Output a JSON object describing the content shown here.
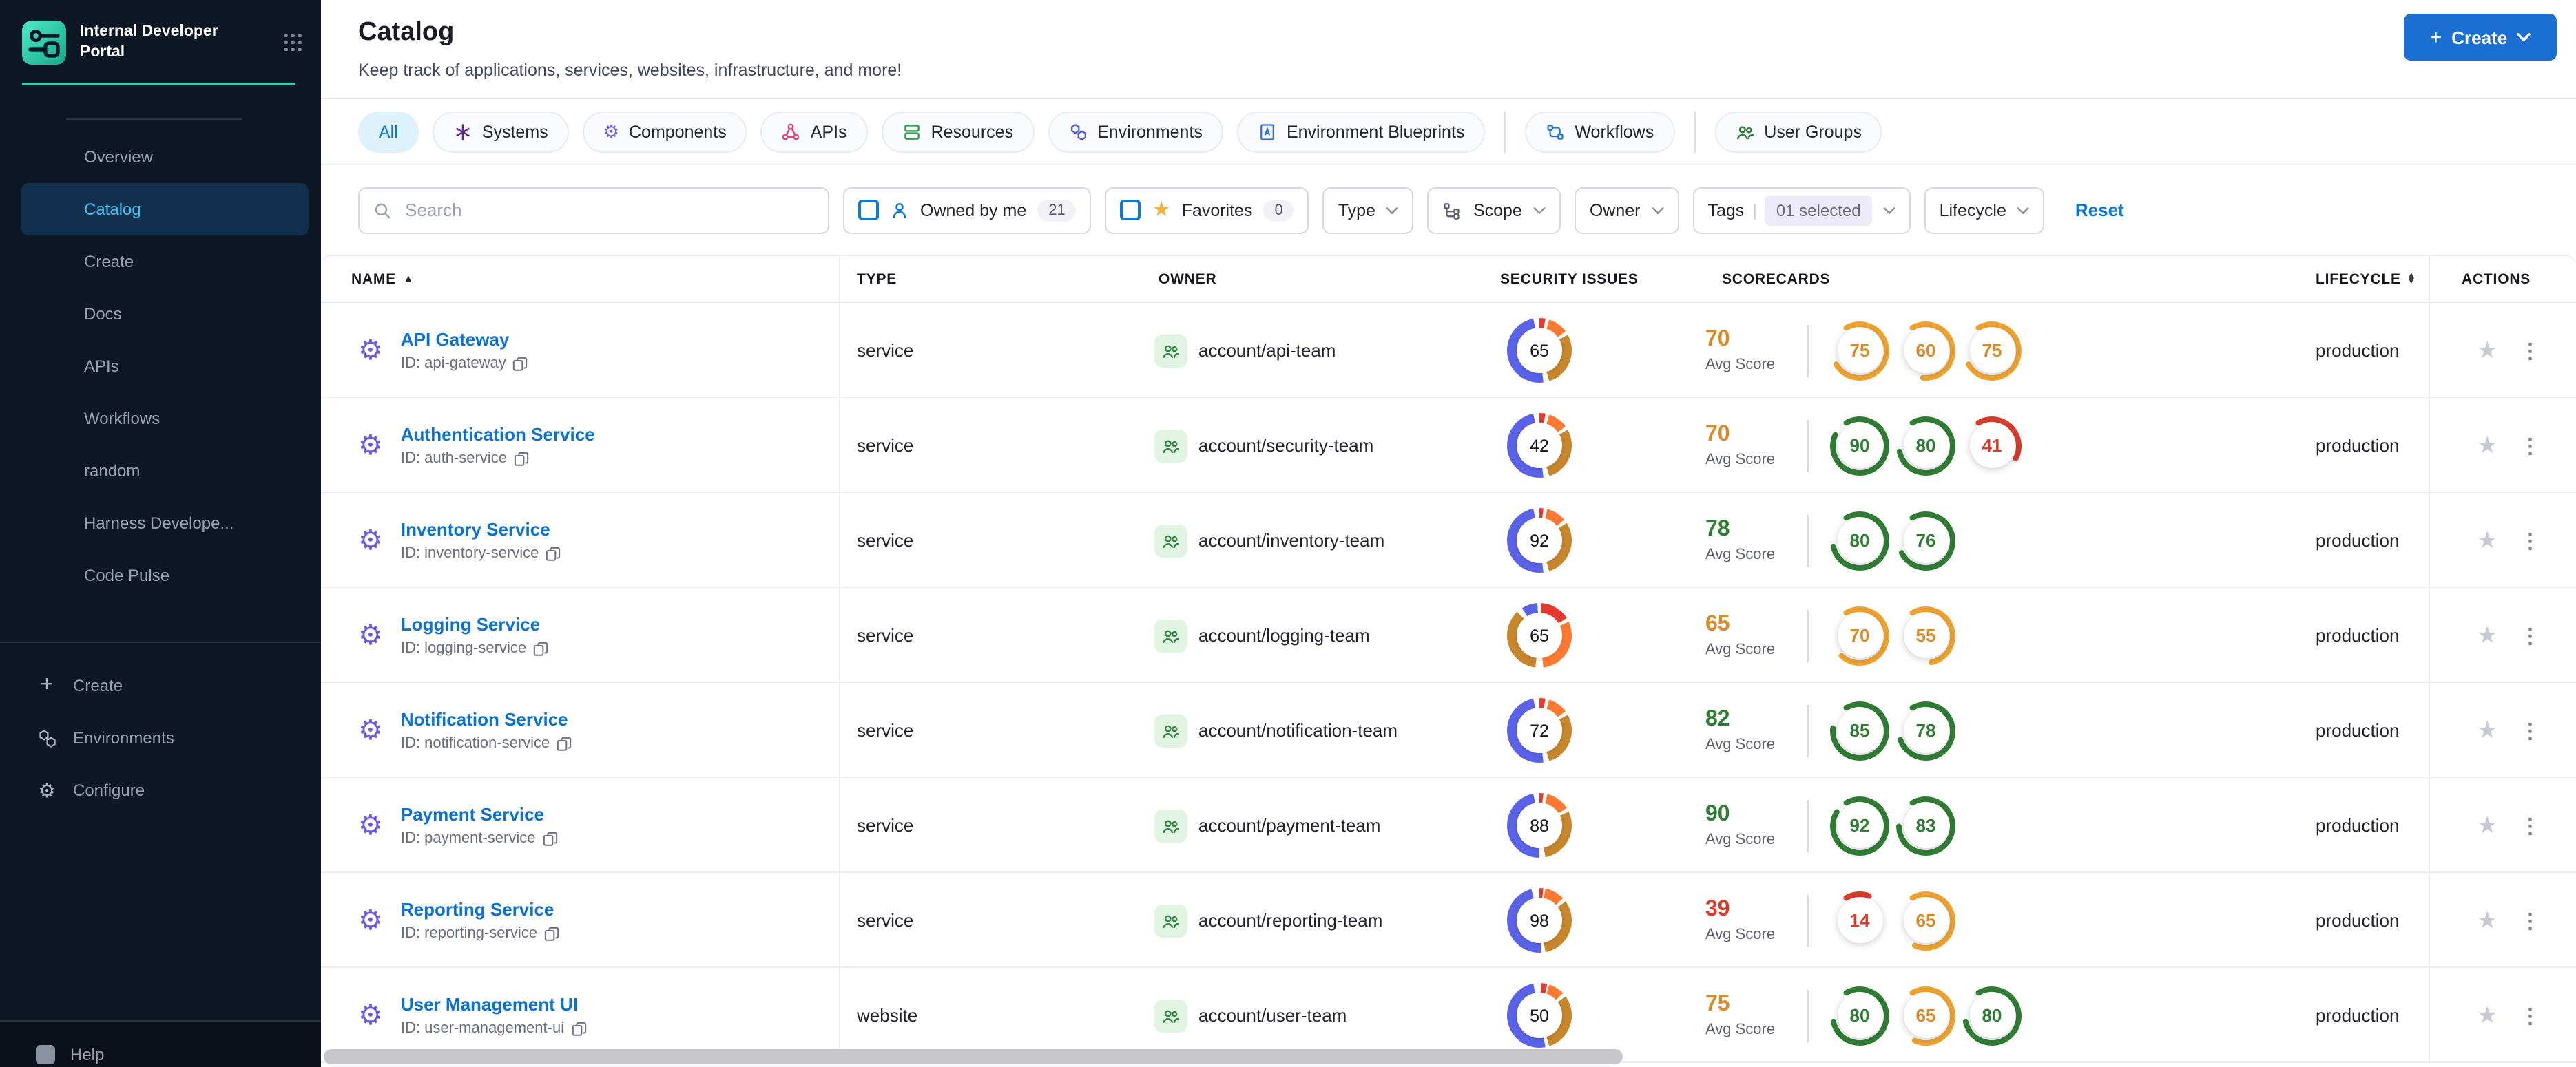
{
  "app_title": "Internal Developer Portal",
  "header": {
    "title": "Catalog",
    "subtitle": "Keep track of applications, services, websites, infrastructure, and more!",
    "create_button": "Create"
  },
  "sidebar": {
    "items": [
      {
        "label": "Overview"
      },
      {
        "label": "Catalog",
        "selected": true
      },
      {
        "label": "Create"
      },
      {
        "label": "Docs"
      },
      {
        "label": "APIs"
      },
      {
        "label": "Workflows"
      },
      {
        "label": "random"
      },
      {
        "label": "Harness Develope..."
      },
      {
        "label": "Code Pulse"
      }
    ],
    "bottom_items": [
      {
        "label": "Create",
        "icon": "plus-icon"
      },
      {
        "label": "Environments",
        "icon": "hexagons-icon"
      },
      {
        "label": "Configure",
        "icon": "gear-icon"
      }
    ],
    "footer_item": {
      "label": "Help",
      "icon": "help-icon"
    }
  },
  "tabs": [
    {
      "label": "All",
      "selected": true
    },
    {
      "label": "Systems",
      "icon": "systems-icon",
      "color": "#5c2d91"
    },
    {
      "label": "Components",
      "icon": "components-icon",
      "color": "#6a5be2"
    },
    {
      "label": "APIs",
      "icon": "apis-icon",
      "color": "#e3447e"
    },
    {
      "label": "Resources",
      "icon": "resources-icon",
      "color": "#2f9e4f"
    },
    {
      "label": "Environments",
      "icon": "environments-icon",
      "color": "#4b52e3"
    },
    {
      "label": "Environment Blueprints",
      "icon": "blueprints-icon",
      "color": "#2e6fd6"
    },
    {
      "label": "Workflows",
      "icon": "workflows-icon",
      "color": "#2173d9",
      "divider_before": true
    },
    {
      "label": "User Groups",
      "icon": "user-groups-icon",
      "color": "#2e7d32",
      "divider_before": true
    }
  ],
  "filters": {
    "search_placeholder": "Search",
    "owned_by_me": {
      "label": "Owned by me",
      "count": "21"
    },
    "favorites": {
      "label": "Favorites",
      "count": "0"
    },
    "type_label": "Type",
    "scope_label": "Scope",
    "owner_label": "Owner",
    "tags_label": "Tags",
    "tags_value": "01 selected",
    "lifecycle_label": "Lifecycle",
    "reset_label": "Reset"
  },
  "table": {
    "columns": {
      "name": "NAME",
      "type": "TYPE",
      "owner": "OWNER",
      "security": "SECURITY ISSUES",
      "scorecards": "SCORECARDS",
      "lifecycle": "LIFECYCLE",
      "actions": "ACTIONS"
    },
    "avg_score_label": "Avg Score",
    "colors": {
      "arc": {
        "green": "#2e7d32",
        "orange": "#f0a32f",
        "red": "#d93a2b"
      },
      "text": {
        "green": "#2e7d32",
        "orange": "#d78a28",
        "red": "#d93a2b"
      },
      "security_palette": {
        "blue": "#5a62e8",
        "red": "#e8382e",
        "orange": "#ff7a30",
        "gold": "#c8862c"
      }
    },
    "rows": [
      {
        "name": "API Gateway",
        "id": "ID: api-gateway",
        "type": "service",
        "owner": "account/api-team",
        "security_issues": 65,
        "security_segments": [
          [
            "red",
            0,
            3
          ],
          [
            "orange",
            5,
            15
          ],
          [
            "gold",
            17,
            45
          ],
          [
            "blue",
            48,
            97
          ]
        ],
        "avg_score": 70,
        "avg_level": "orange",
        "scorecards": [
          [
            75,
            "orange"
          ],
          [
            60,
            "orange"
          ],
          [
            75,
            "orange"
          ]
        ],
        "lifecycle": "production"
      },
      {
        "name": "Authentication Service",
        "id": "ID: auth-service",
        "type": "service",
        "owner": "account/security-team",
        "security_issues": 42,
        "security_segments": [
          [
            "red",
            0,
            3
          ],
          [
            "orange",
            5,
            15
          ],
          [
            "gold",
            17,
            45
          ],
          [
            "blue",
            48,
            97
          ]
        ],
        "avg_score": 70,
        "avg_level": "orange",
        "scorecards": [
          [
            90,
            "green"
          ],
          [
            80,
            "green"
          ],
          [
            41,
            "red"
          ]
        ],
        "lifecycle": "production"
      },
      {
        "name": "Inventory Service",
        "id": "ID: inventory-service",
        "type": "service",
        "owner": "account/inventory-team",
        "security_issues": 92,
        "security_segments": [
          [
            "red",
            0,
            2
          ],
          [
            "orange",
            4,
            14
          ],
          [
            "gold",
            16,
            45
          ],
          [
            "blue",
            48,
            97
          ]
        ],
        "avg_score": 78,
        "avg_level": "green",
        "scorecards": [
          [
            80,
            "green"
          ],
          [
            76,
            "green"
          ]
        ],
        "lifecycle": "production"
      },
      {
        "name": "Logging Service",
        "id": "ID: logging-service",
        "type": "service",
        "owner": "account/logging-team",
        "security_issues": 65,
        "security_segments": [
          [
            "red",
            1,
            16
          ],
          [
            "orange",
            18,
            48
          ],
          [
            "gold",
            52,
            88
          ],
          [
            "blue",
            91,
            99
          ]
        ],
        "avg_score": 65,
        "avg_level": "orange",
        "scorecards": [
          [
            70,
            "orange"
          ],
          [
            55,
            "orange"
          ]
        ],
        "lifecycle": "production"
      },
      {
        "name": "Notification Service",
        "id": "ID: notification-service",
        "type": "service",
        "owner": "account/notification-team",
        "security_issues": 72,
        "security_segments": [
          [
            "red",
            0,
            3
          ],
          [
            "orange",
            5,
            15
          ],
          [
            "gold",
            17,
            45
          ],
          [
            "blue",
            48,
            97
          ]
        ],
        "avg_score": 82,
        "avg_level": "green",
        "scorecards": [
          [
            85,
            "green"
          ],
          [
            78,
            "green"
          ]
        ],
        "lifecycle": "production"
      },
      {
        "name": "Payment Service",
        "id": "ID: payment-service",
        "type": "service",
        "owner": "account/payment-team",
        "security_issues": 88,
        "security_segments": [
          [
            "red",
            0,
            2
          ],
          [
            "orange",
            4,
            16
          ],
          [
            "gold",
            18,
            47
          ],
          [
            "blue",
            50,
            97
          ]
        ],
        "avg_score": 90,
        "avg_level": "green",
        "scorecards": [
          [
            92,
            "green"
          ],
          [
            83,
            "green"
          ]
        ],
        "lifecycle": "production"
      },
      {
        "name": "Reporting Service",
        "id": "ID: reporting-service",
        "type": "service",
        "owner": "account/reporting-team",
        "security_issues": 98,
        "security_segments": [
          [
            "red",
            0,
            2
          ],
          [
            "orange",
            3,
            13
          ],
          [
            "gold",
            15,
            47
          ],
          [
            "blue",
            49,
            96
          ]
        ],
        "avg_score": 39,
        "avg_level": "red",
        "scorecards": [
          [
            14,
            "red"
          ],
          [
            65,
            "orange"
          ]
        ],
        "lifecycle": "production"
      },
      {
        "name": "User Management UI",
        "id": "ID: user-management-ui",
        "type": "website",
        "owner": "account/user-team",
        "security_issues": 50,
        "security_segments": [
          [
            "red",
            1,
            4
          ],
          [
            "orange",
            5,
            13
          ],
          [
            "gold",
            15,
            45
          ],
          [
            "blue",
            47,
            97
          ]
        ],
        "avg_score": 75,
        "avg_level": "orange",
        "scorecards": [
          [
            80,
            "green"
          ],
          [
            65,
            "orange"
          ],
          [
            80,
            "green"
          ]
        ],
        "lifecycle": "production"
      }
    ]
  }
}
